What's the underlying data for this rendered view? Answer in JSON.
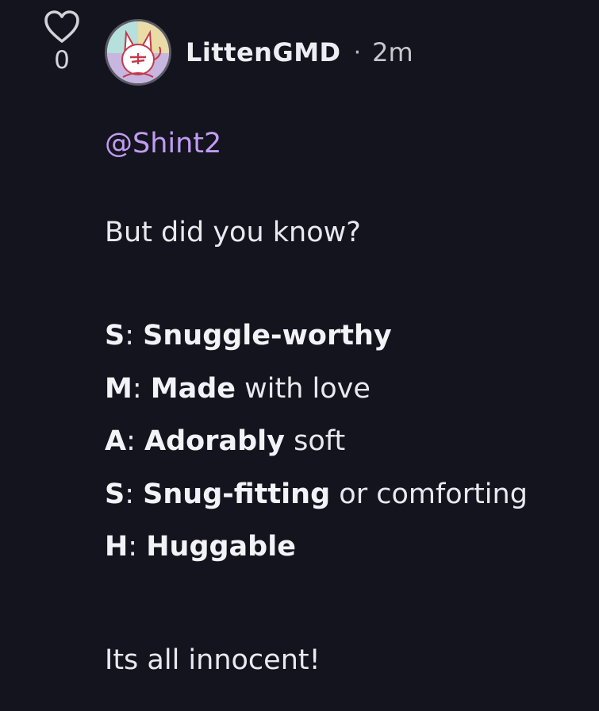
{
  "post": {
    "like_count": "0",
    "author": "LittenGMD",
    "separator": "·",
    "time_ago": "2m",
    "mention": "@Shint2",
    "intro": "But did you know?",
    "acronym": [
      {
        "letter": "S",
        "colon": ":",
        "bold_word": "Snuggle-worthy",
        "rest": ""
      },
      {
        "letter": "M",
        "colon": ":",
        "bold_word": "Made",
        "rest": " with love"
      },
      {
        "letter": "A",
        "colon": ":",
        "bold_word": "Adorably",
        "rest": " soft"
      },
      {
        "letter": "S",
        "colon": ":",
        "bold_word": "Snug-fitting",
        "rest": " or comforting"
      },
      {
        "letter": "H",
        "colon": ":",
        "bold_word": "Huggable",
        "rest": ""
      }
    ],
    "outro": "Its all innocent!"
  },
  "colors": {
    "background": "#14141e",
    "mention": "#c09cf2",
    "text": "#e9e9ef"
  },
  "icons": {
    "like": "heart-outline-icon",
    "avatar": "cat-avatar-image"
  }
}
